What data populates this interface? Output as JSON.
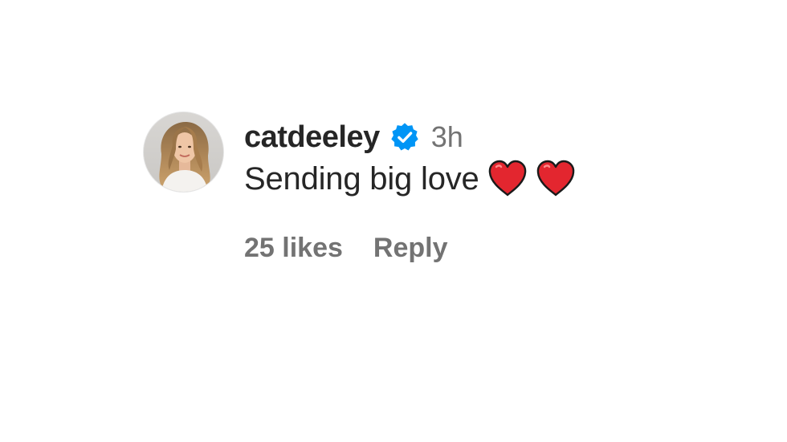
{
  "comment": {
    "username": "catdeeley",
    "verified_icon": "verified-badge-icon",
    "time": "3h",
    "text": "Sending big love",
    "emojis": [
      "❤️",
      "❤️"
    ],
    "likes": "25 likes",
    "reply_label": "Reply",
    "colors": {
      "username": "#262626",
      "meta": "#737373",
      "verified": "#0095f6",
      "heart": "#e3262f"
    }
  }
}
